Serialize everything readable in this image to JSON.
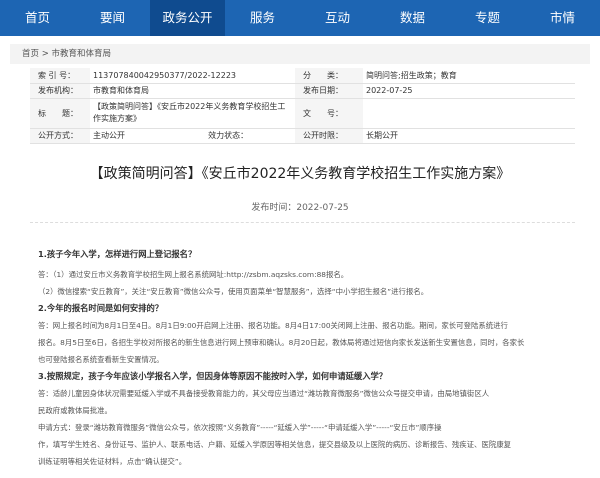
{
  "nav": [
    {
      "label": "首页",
      "active": false
    },
    {
      "label": "要闻",
      "active": false
    },
    {
      "label": "政务公开",
      "active": true
    },
    {
      "label": "服务",
      "active": false
    },
    {
      "label": "互动",
      "active": false
    },
    {
      "label": "数据",
      "active": false
    },
    {
      "label": "专题",
      "active": false
    },
    {
      "label": "市情",
      "active": false
    }
  ],
  "breadcrumb": {
    "home": "首页",
    "sep": ">",
    "current": "市教育和体育局"
  },
  "info": {
    "index_label": "索 引 号：",
    "index_value": "11370784004295037​7/2022-12223",
    "category_label": "分　　类：",
    "category_value": "简明问答;招生政策；教育",
    "publisher_label": "发布机构：",
    "publisher_value": "市教育和体育局",
    "date_label": "发布日期：",
    "date_value": "2022-07-25",
    "title_label": "标　　题：",
    "title_value": "【政策简明问答】《安丘市2022年义务教育学校招生工作实施方案》",
    "docno_label": "文　　号：",
    "docno_value": "",
    "method_label": "公开方式：",
    "method_value": "主动公开",
    "effect_label": "效力状态：",
    "effect_value": "",
    "period_label": "公开时限：",
    "period_value": "长期公开"
  },
  "doc": {
    "title": "【政策简明问答】《安丘市2022年义务教育学校招生工作实施方案》",
    "date": "发布时间：2022-07-25"
  },
  "content": {
    "q1": "1.孩子今年入学，怎样进行网上登记报名？",
    "a1_1": "答：（1）通过安丘市义务教育学校招生网上报名系统网址:http://zsbm.aqzsks.com:88报名。",
    "a1_2": "（2）微信搜索“安丘教育”，关注“安丘教育”微信公众号，使用页面菜单“智慧服务”，选择“中小学招生报名”进行报名。",
    "q2": "2.今年的报名时间是如何安排的？",
    "a2_1": "答：网上报名时间为8月1日至4日。8月1日9:00开启网上注册、报名功能。8月4日17:00关闭网上注册、报名功能。期间，家长可登陆系统进行",
    "a2_2": "报名。8月5日至6日，各招生学校对所报名的新生信息进行网上预审和确认。8月20日起，教体局将通过短信向家长发送新生安置信息，同时，各家长",
    "a2_3": "也可登陆报名系统查看新生安置情况。",
    "q3": "3.按照规定，孩子今年应该小学报名入学，但因身体等原因不能按时入学，如何申请延缓入学？",
    "a3_1": "答：适龄儿童因身体状况需要延缓入学或不具备接受教育能力的，其父母应当通过“潍坊教育微服务”微信公众号提交申请，由局地镇街区人",
    "a3_2": "民政府或教体局批准。",
    "a3_3": "申请方式：登录“潍坊教育微服务”微信公众号，依次按照“义务教育”-----“延缓入学”-----“申请延缓入学”-----“安丘市”顺序操",
    "a3_4": "作，填写学生姓名、身份证号、监护人、联系电话、户籍、延缓入学原因等相关信息，提交县级及以上医院的病历、诊断报告、残疾证、医院康复",
    "a3_5": "训练证明等相关佐证材料，点击“确认提交”。"
  }
}
